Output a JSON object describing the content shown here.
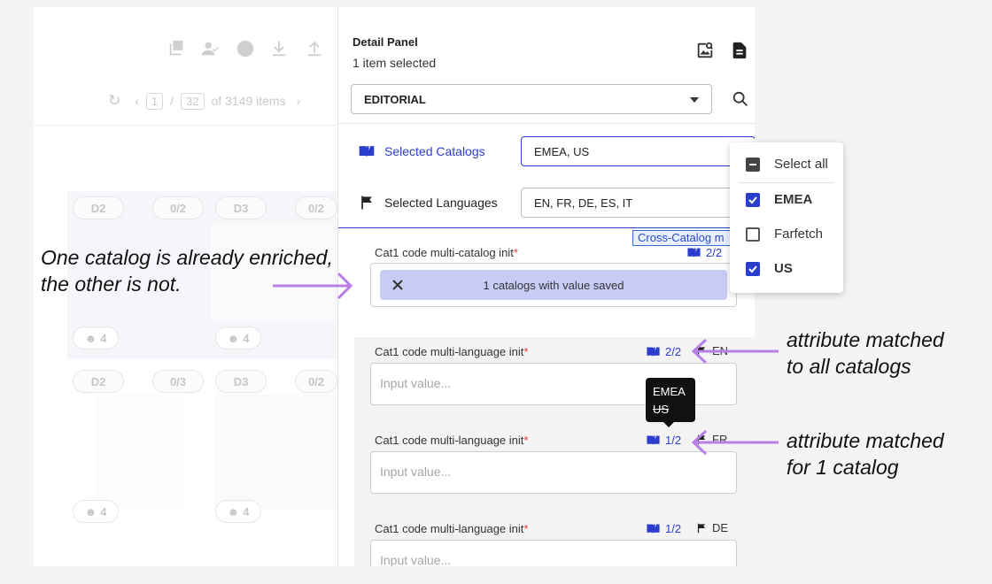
{
  "background_app": {
    "pager": {
      "current": "1",
      "total": "32",
      "items_text": "of 3149 items"
    },
    "grid": {
      "row1_tags": [
        "D2",
        "0/2",
        "D3",
        "0/2"
      ],
      "row1_counts": [
        "4",
        "4"
      ],
      "row2_tags": [
        "D2",
        "0/3",
        "D3",
        "0/2"
      ],
      "row2_counts": [
        "4",
        "4"
      ]
    }
  },
  "detail_panel": {
    "title": "Detail Panel",
    "subtitle": "1 item selected",
    "view_select": {
      "value": "EDITORIAL"
    },
    "selected_catalogs": {
      "label": "Selected Catalogs",
      "value": "EMEA, US"
    },
    "selected_languages": {
      "label": "Selected Languages",
      "value": "EN, FR, DE, ES, IT"
    },
    "cross_catalog_tag": "Cross-Catalog m",
    "attributes": [
      {
        "label": "Cat1 code multi-catalog init",
        "required_mark": "*",
        "match": "2/2",
        "saved_text": "1 catalogs with value saved"
      },
      {
        "label": "Cat1 code multi-language init",
        "required_mark": "*",
        "match": "2/2",
        "lang": "EN",
        "placeholder": "Input value..."
      },
      {
        "label": "Cat1 code multi-language init",
        "required_mark": "*",
        "match": "1/2",
        "lang": "FR",
        "placeholder": "Input value..."
      },
      {
        "label": "Cat1 code multi-language init",
        "required_mark": "*",
        "match": "1/2",
        "lang": "DE",
        "placeholder": "Input value..."
      }
    ],
    "tooltip": {
      "line1": "EMEA",
      "line2": "US"
    }
  },
  "catalog_menu": {
    "items": [
      {
        "label": "Select all",
        "state": "indeterminate"
      },
      {
        "label": "EMEA",
        "state": "checked"
      },
      {
        "label": "Farfetch",
        "state": "unchecked"
      },
      {
        "label": "US",
        "state": "checked"
      }
    ]
  },
  "annotations": {
    "left_line1": "One catalog is already enriched,",
    "left_line2": "the other is not.",
    "right1_line1": "attribute matched",
    "right1_line2": "to all catalogs",
    "right2_line1": "attribute matched",
    "right2_line2": "for 1 catalog"
  },
  "colors": {
    "accent": "#2a3dcc",
    "chip": "#c7ccf7",
    "annotation_arrow": "#b77ee6",
    "required": "#e23b3b"
  }
}
